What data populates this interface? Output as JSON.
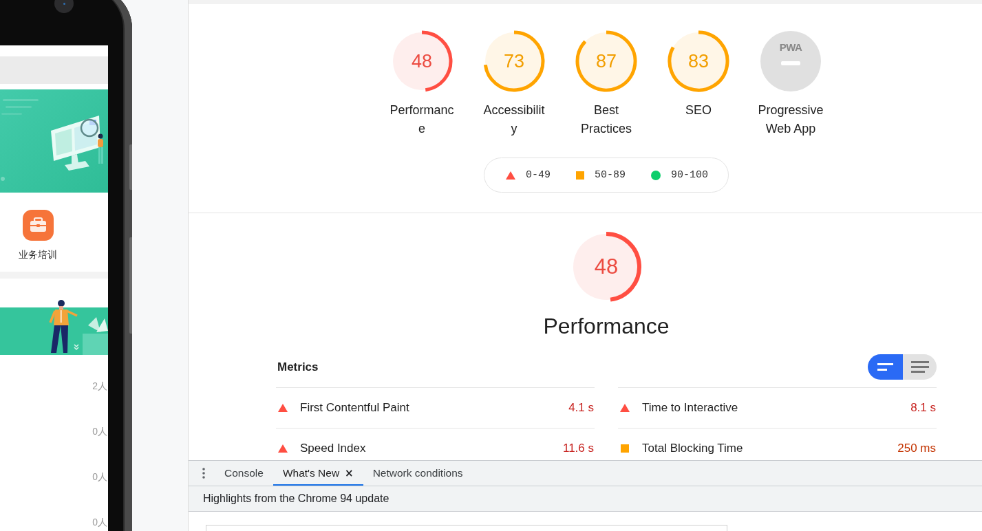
{
  "device_preview": {
    "menu_items": [
      {
        "label": "业务培训"
      }
    ],
    "counts": [
      "2人",
      "0人",
      "0人",
      "0人"
    ]
  },
  "category_gauges": [
    {
      "kind": "fail",
      "score": "48",
      "label_lines": [
        "Performanc",
        "e"
      ]
    },
    {
      "kind": "average",
      "score": "73",
      "label_lines": [
        "Accessibilit",
        "y"
      ]
    },
    {
      "kind": "average",
      "score": "87",
      "label_lines": [
        "Best",
        "Practices"
      ]
    },
    {
      "kind": "average",
      "score": "83",
      "label_lines": [
        "SEO"
      ]
    },
    {
      "kind": "pwa",
      "badge": "PWA",
      "label_lines": [
        "Progressive",
        "Web App"
      ]
    }
  ],
  "legend": [
    {
      "kind": "fail",
      "range": "0-49"
    },
    {
      "kind": "average",
      "range": "50-89"
    },
    {
      "kind": "pass",
      "range": "90-100"
    }
  ],
  "performance": {
    "kind": "fail",
    "score": "48",
    "title": "Performance"
  },
  "metrics": {
    "title": "Metrics",
    "view_toggle": [
      {
        "kind": "compact",
        "selected": true
      },
      {
        "kind": "list",
        "selected": false
      }
    ],
    "items": [
      {
        "kind": "fail",
        "name": "First Contentful Paint",
        "value": "4.1 s"
      },
      {
        "kind": "fail",
        "name": "Time to Interactive",
        "value": "8.1 s"
      },
      {
        "kind": "fail",
        "name": "Speed Index",
        "value": "11.6 s"
      },
      {
        "kind": "average",
        "name": "Total Blocking Time",
        "value": "250 ms"
      }
    ]
  },
  "drawer": {
    "tabs": [
      {
        "label": "Console",
        "selected": false
      },
      {
        "label": "What's New",
        "selected": true,
        "close": "×"
      },
      {
        "label": "Network conditions",
        "selected": false
      }
    ],
    "title": "Highlights from the Chrome 94 update"
  }
}
